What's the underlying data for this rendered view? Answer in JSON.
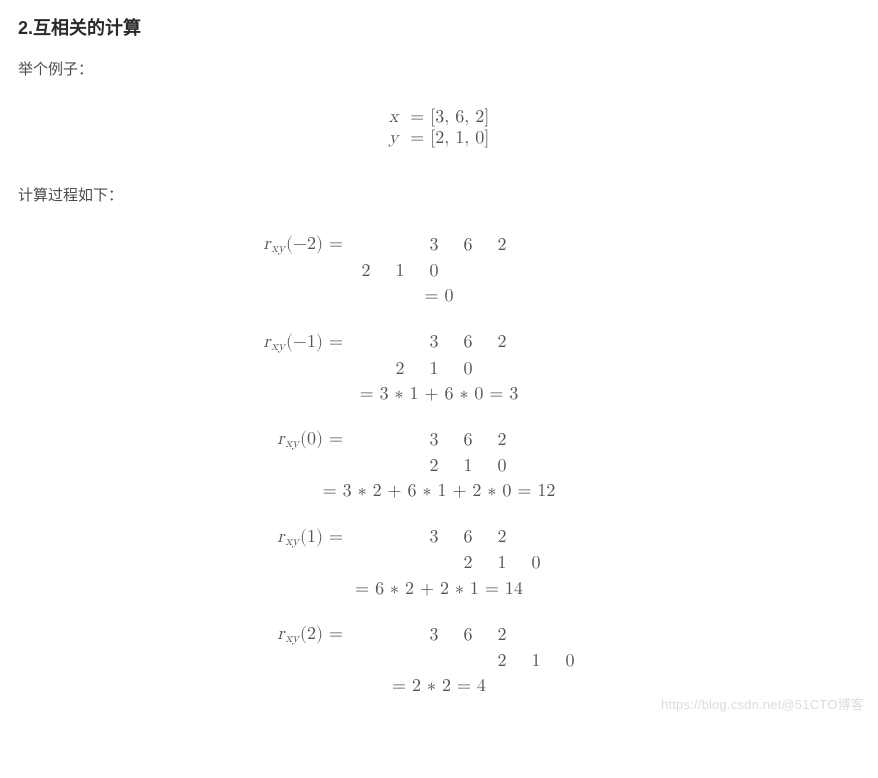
{
  "title": "2.互相关的计算",
  "exampleLabel": "举个例子：",
  "given": {
    "xLine": "x = [3, 6, 2]",
    "yLine": "y = [2, 1, 0]",
    "x_var": "x",
    "y_var": "y",
    "x_vals": "[3, 6, 2]",
    "y_vals": "[2, 1, 0]"
  },
  "procLabel": "计算过程如下：",
  "func": {
    "name": "r",
    "sub": "xy"
  },
  "x_row": [
    "3",
    "6",
    "2"
  ],
  "y_row": [
    "2",
    "1",
    "0"
  ],
  "calcs": [
    {
      "arg": "−2",
      "result": "= 0"
    },
    {
      "arg": "−1",
      "result": "= 3 ∗ 1 + 6 ∗ 0 = 3"
    },
    {
      "arg": "0",
      "result": "= 3 ∗ 2 + 6 ∗ 1 + 2 ∗ 0 = 12"
    },
    {
      "arg": "1",
      "result": "= 6 ∗ 2 + 2 ∗ 1 = 14"
    },
    {
      "arg": "2",
      "result": "= 2 ∗ 2 = 4"
    }
  ],
  "watermark": "https://blog.csdn.net@51CTO博客"
}
